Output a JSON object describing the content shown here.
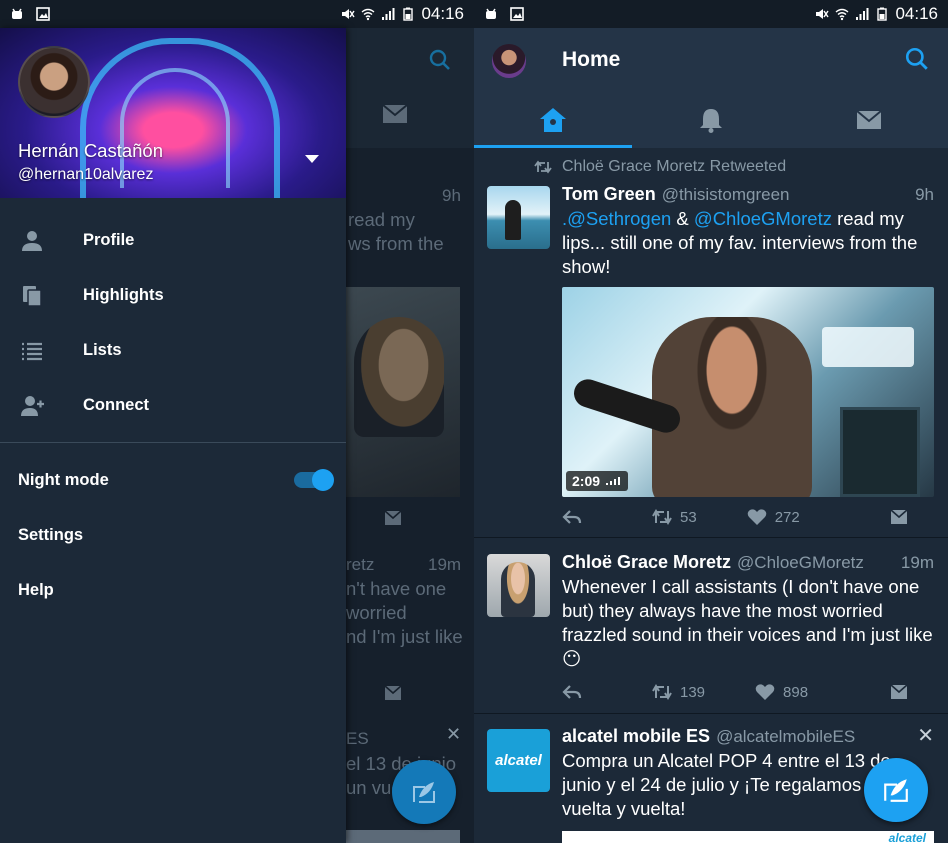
{
  "status_bar": {
    "time": "04:16"
  },
  "colors": {
    "accent": "#1da1f2",
    "background": "#1c2938",
    "header": "#243447",
    "muted": "#8899a6"
  },
  "drawer": {
    "name": "Hernán Castañón",
    "handle": "@hernan10alvarez",
    "menu": [
      {
        "label": "Profile",
        "icon": "person-icon"
      },
      {
        "label": "Highlights",
        "icon": "highlights-icon"
      },
      {
        "label": "Lists",
        "icon": "lists-icon"
      },
      {
        "label": "Connect",
        "icon": "add-person-icon"
      }
    ],
    "night_mode_label": "Night mode",
    "night_mode_on": true,
    "settings_label": "Settings",
    "help_label": "Help"
  },
  "dimmed_timeline": {
    "time1": "9h",
    "line1": "read my",
    "line2": "ws from the",
    "handle_fragment": "retz",
    "time2": "19m",
    "line3": "n't have one",
    "line4": "worried",
    "line5": "nd I'm just like",
    "line6": "ES",
    "line7": "el 13 de junio",
    "line8": "un vuelta"
  },
  "home": {
    "title": "Home",
    "tabs": [
      {
        "name": "home-tab",
        "icon": "home-icon",
        "active": true
      },
      {
        "name": "notifications-tab",
        "icon": "bell-icon",
        "active": false
      },
      {
        "name": "messages-tab",
        "icon": "envelope-icon",
        "active": false
      }
    ],
    "tweets": [
      {
        "retweeted_by": "Chloë Grace Moretz Retweeted",
        "name": "Tom Green",
        "handle": "@thisistomgreen",
        "time": "9h",
        "mention1": ".@Sethrogen",
        "amp": " & ",
        "mention2": "@ChloeGMoretz",
        "text": " read my lips... still one of my fav. interviews from the show!",
        "video_duration": "2:09",
        "retweets": "53",
        "likes": "272"
      },
      {
        "name": "Chloë Grace Moretz",
        "handle": "@ChloeGMoretz",
        "time": "19m",
        "text": "Whenever I call assistants (I don't have one but) they always have the most worried frazzled sound in their voices and I'm just like 😶",
        "retweets": "139",
        "likes": "898"
      },
      {
        "name": "alcatel mobile ES",
        "handle": "@alcatelmobileES",
        "logo_text": "alcatel",
        "text": "Compra un Alcatel POP 4 entre el 13 de junio y el 24 de julio y ¡Te regalamos un vuelta y vuelta!",
        "footer_logo": "alcatel"
      }
    ]
  }
}
